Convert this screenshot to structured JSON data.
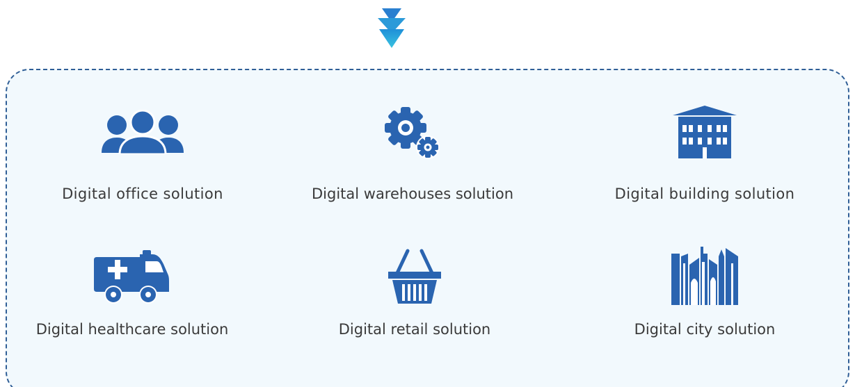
{
  "colors": {
    "icon": "#2a64b0",
    "border": "#2f5e96",
    "panel_bg": "#f2f9fd",
    "arrow_top": "#1f8fd8",
    "arrow_bottom": "#39c3e0",
    "text": "#3a3a3a"
  },
  "solutions": [
    {
      "icon": "people-icon",
      "label": "Digital office solution"
    },
    {
      "icon": "gears-icon",
      "label": "Digital warehouses solution"
    },
    {
      "icon": "building-icon",
      "label": "Digital building solution"
    },
    {
      "icon": "ambulance-icon",
      "label": "Digital healthcare solution"
    },
    {
      "icon": "basket-icon",
      "label": "Digital retail solution"
    },
    {
      "icon": "city-icon",
      "label": "Digital city solution"
    }
  ]
}
